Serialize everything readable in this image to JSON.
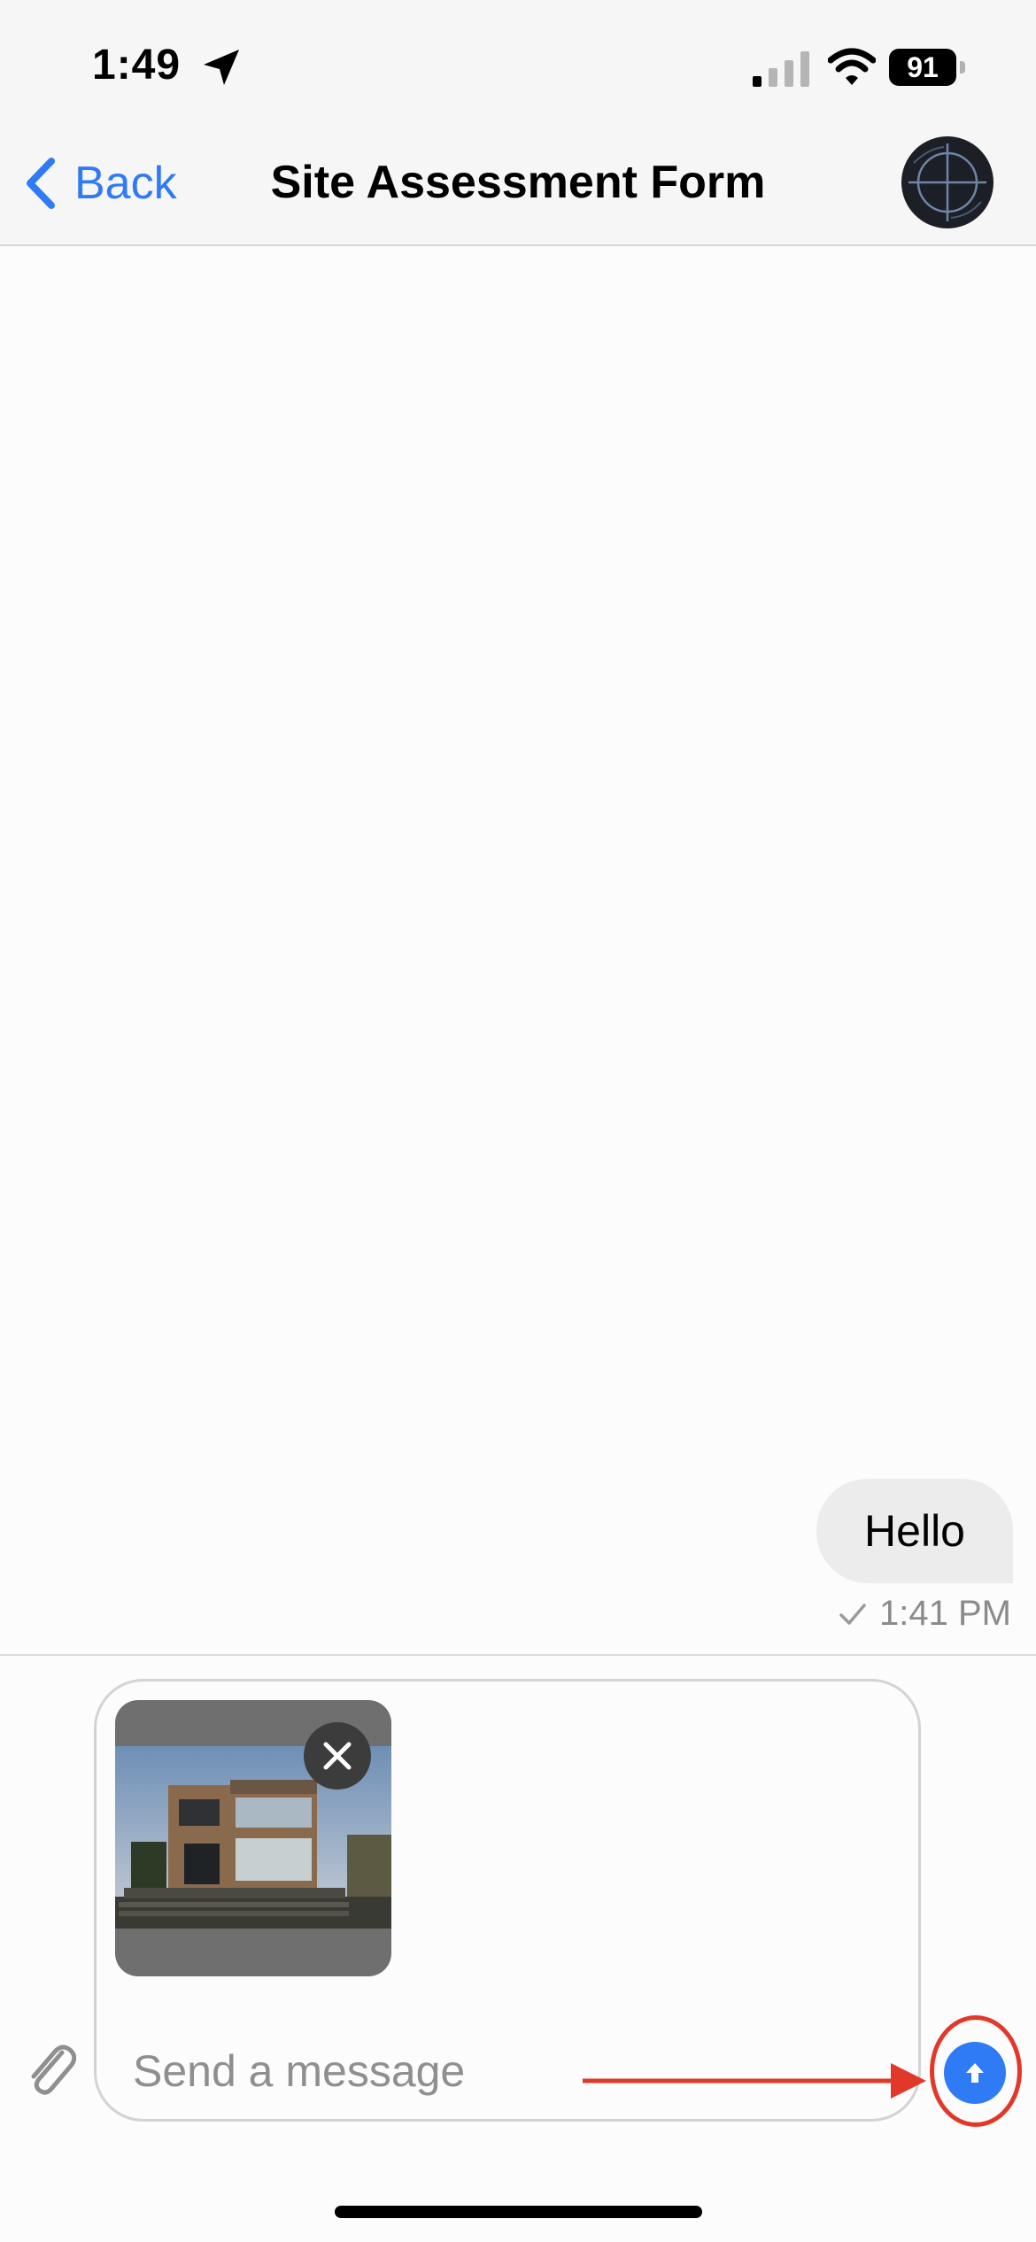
{
  "status_bar": {
    "time": "1:49",
    "battery": "91"
  },
  "nav": {
    "back_label": "Back",
    "title": "Site Assessment Form"
  },
  "messages": [
    {
      "text": "Hello",
      "time": "1:41 PM",
      "status_icon": "check-icon"
    }
  ],
  "composer": {
    "placeholder": "Send a message",
    "value": ""
  },
  "colors": {
    "accent": "#2f7bf5",
    "annotation": "#e1382a",
    "bubble": "#ececec"
  }
}
